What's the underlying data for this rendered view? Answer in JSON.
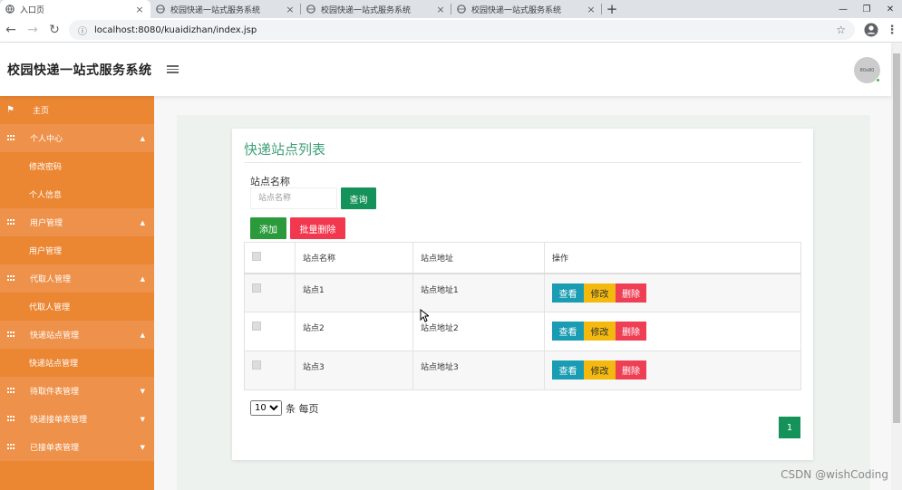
{
  "browser": {
    "tabs": [
      {
        "title": "入口页",
        "active": true
      },
      {
        "title": "校园快递一站式服务系统",
        "active": false
      },
      {
        "title": "校园快递一站式服务系统",
        "active": false
      },
      {
        "title": "校园快递一站式服务系统",
        "active": false
      }
    ],
    "url": "localhost:8080/kuaidizhan/index.jsp"
  },
  "header": {
    "title": "校园快递一站式服务系统",
    "avatar_text": "80x80"
  },
  "sidebar": {
    "items": [
      {
        "label": "主页",
        "kind": "home"
      },
      {
        "label": "个人中心",
        "kind": "top"
      },
      {
        "label": "修改密码",
        "kind": "sub"
      },
      {
        "label": "个人信息",
        "kind": "sub"
      },
      {
        "label": "用户管理",
        "kind": "top"
      },
      {
        "label": "用户管理",
        "kind": "sub"
      },
      {
        "label": "代取人管理",
        "kind": "top"
      },
      {
        "label": "代取人管理",
        "kind": "sub"
      },
      {
        "label": "快递站点管理",
        "kind": "top"
      },
      {
        "label": "快递站点管理",
        "kind": "sub"
      },
      {
        "label": "待取件表管理",
        "kind": "top"
      },
      {
        "label": "快递接单表管理",
        "kind": "top"
      },
      {
        "label": "已接单表管理",
        "kind": "top"
      }
    ]
  },
  "content": {
    "title": "快递站点列表",
    "search_label": "站点名称",
    "search_placeholder": "站点名称",
    "query_button": "查询",
    "add_button": "添加",
    "bulk_delete_button": "批量删除",
    "columns": [
      "站点名称",
      "站点地址",
      "操作"
    ],
    "rows": [
      {
        "name": "站点1",
        "address": "站点地址1"
      },
      {
        "name": "站点2",
        "address": "站点地址2"
      },
      {
        "name": "站点3",
        "address": "站点地址3"
      }
    ],
    "actions": {
      "view": "查看",
      "edit": "修改",
      "delete": "删除"
    },
    "page_size": "10",
    "page_size_suffix": "条 每页",
    "current_page": "1"
  },
  "watermark": "CSDN @wishCoding",
  "colors": {
    "sidebar": "#eb8633",
    "accent": "#14925a",
    "title": "#3e9f78"
  }
}
